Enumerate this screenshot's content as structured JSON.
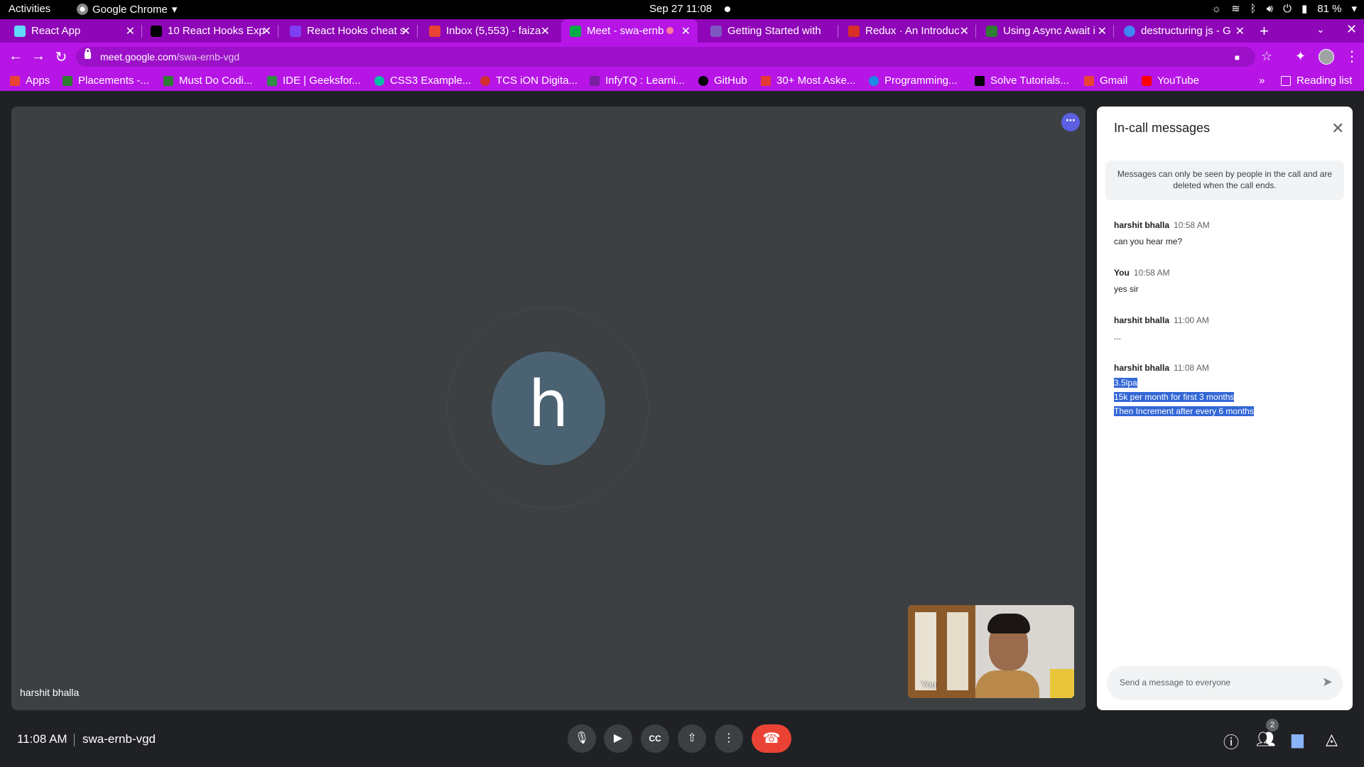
{
  "system": {
    "activities": "Activities",
    "app_name": "Google Chrome",
    "clock": "Sep 27  11:08",
    "battery": "81 %"
  },
  "tabs": [
    {
      "title": "React App",
      "fav": "#61dafb"
    },
    {
      "title": "10 React Hooks Exp",
      "fav": "#000000"
    },
    {
      "title": "React Hooks cheat s",
      "fav": "#7e3ff2"
    },
    {
      "title": "Inbox (5,553) - faiza",
      "fav": "#ea4335"
    },
    {
      "title": "Meet - swa-ernb",
      "fav": "#00ac47"
    },
    {
      "title": "Getting Started with",
      "fav": "#7e57c2"
    },
    {
      "title": "Redux · An Introduc",
      "fav": "#d93025"
    },
    {
      "title": "Using Async Await i",
      "fav": "#2e7d32"
    },
    {
      "title": "destructuring js - G",
      "fav": "#4285f4"
    }
  ],
  "address": {
    "domain": "meet.google.com",
    "path": "/swa-ernb-vgd"
  },
  "bookmarks": [
    {
      "label": "Apps",
      "color": "#ea4335"
    },
    {
      "label": "Placements -...",
      "color": "#2e7d32"
    },
    {
      "label": "Must Do Codi...",
      "color": "#2e7d32"
    },
    {
      "label": "IDE | Geeksfor...",
      "color": "#2f8d46"
    },
    {
      "label": "CSS3 Example...",
      "color": "#00bfa5"
    },
    {
      "label": "TCS iON Digita...",
      "color": "#d32f2f"
    },
    {
      "label": "InfyTQ : Learni...",
      "color": "#7b1fa2"
    },
    {
      "label": "GitHub",
      "color": "#000000"
    },
    {
      "label": "30+ Most Aske...",
      "color": "#e53935"
    },
    {
      "label": "Programming...",
      "color": "#1e88e5"
    },
    {
      "label": "Solve Tutorials...",
      "color": "#000000"
    },
    {
      "label": "Gmail",
      "color": "#ea4335"
    },
    {
      "label": "YouTube",
      "color": "#ff0000"
    }
  ],
  "bookmarks_overflow": "»",
  "reading_list": "Reading list",
  "stage": {
    "avatar_letter": "h",
    "speaker_name": "harshit bhalla",
    "self_label": "You"
  },
  "chat": {
    "title": "In-call messages",
    "notice": "Messages can only be seen by people in the call and are deleted when the call ends.",
    "messages": [
      {
        "sender": "harshit bhalla",
        "time": "10:58 AM",
        "lines": [
          "can you hear me?"
        ]
      },
      {
        "sender": "You",
        "time": "10:58 AM",
        "lines": [
          "yes sir"
        ]
      },
      {
        "sender": "harshit bhalla",
        "time": "11:00 AM",
        "lines": [
          "..."
        ]
      },
      {
        "sender": "harshit bhalla",
        "time": "11:08 AM",
        "lines": [
          "3.5lpa",
          "15k per month for first 3 months",
          "Then Increment after every 6 months"
        ]
      }
    ],
    "compose_placeholder": "Send a message to everyone"
  },
  "bottom": {
    "time": "11:08 AM",
    "meeting_code": "swa-ernb-vgd",
    "participant_count": "2"
  },
  "colors": {
    "tab_strip": "#8e06b7",
    "toolbar": "#b615e6",
    "stage": "#3c4043",
    "end_call": "#ea4335",
    "highlight": "#3367d6"
  }
}
